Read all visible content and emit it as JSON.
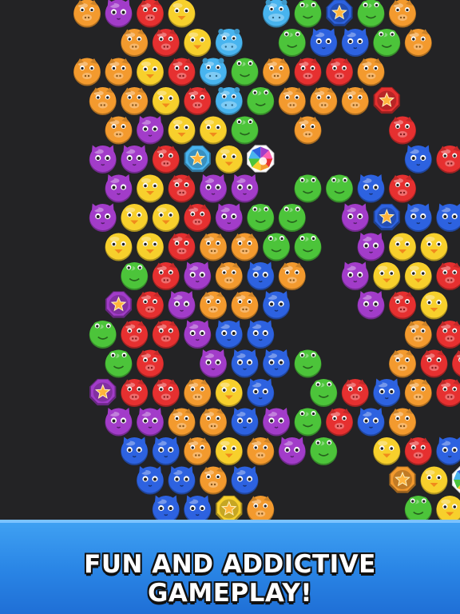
{
  "banner": {
    "text": "FUN AND ADDICTIVE GAMEPLAY!"
  },
  "palette": {
    "orange": "#f39a2e",
    "purple": "#a23cc9",
    "red": "#e63030",
    "yellow": "#f7d02c",
    "cyan": "#48b4ef",
    "green": "#4cc43a",
    "blue": "#2d62e0",
    "background": "#232325",
    "banner": "#2a86e6"
  },
  "legend": {
    "o": "orange-pig",
    "p": "purple-cat",
    "r": "red-pig",
    "y": "yellow-chick",
    "c": "cyan-hippo",
    "g": "green-frog",
    "b": "blue-cat",
    "O": "orange-star-coin",
    "P": "purple-star-coin",
    "C": "cyan-star-coin",
    "B": "blue-star-coin",
    "R": "red-star-coin",
    "Y": "yellow-star-coin",
    "M": "rainbow-bomb",
    ".": "empty"
  },
  "grid": [
    "..opry..cgBgo",
    "...oryc.gbbgo.",
    "..ooyrcgorro.",
    "..ooyrcgoooR.",
    "...opyyg.o..r",
    "..pprCyM....br",
    "...pyrpp.ggbr",
    "..pyyrpgg.pBbb",
    "...yyroogg.pyy",
    "...grpobo.pyyr",
    "...Prpoob..pry",
    "..grrpbb....orr",
    "...gr.pbbg..orr",
    "..Prroyb.grbor",
    "...ppoobpgrbo",
    "...bboyopg.yrbb",
    "....bbob....OyM",
    "....bbYo....gy"
  ]
}
